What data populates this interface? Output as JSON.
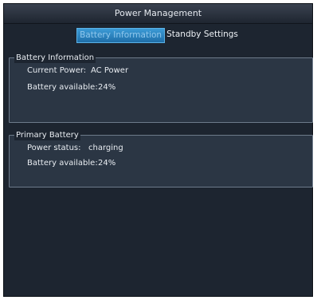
{
  "window": {
    "title": "Power Management"
  },
  "tabs": [
    {
      "label": "Battery Information",
      "active": true
    },
    {
      "label": "Standby Settings",
      "active": false
    }
  ],
  "battery_information": {
    "title": "Battery Information",
    "current_power_label": "Current Power:",
    "current_power_value": "AC Power",
    "battery_available_label": "Battery available:",
    "battery_available_value": "24%"
  },
  "primary_battery": {
    "title": "Primary Battery",
    "power_status_label": "Power status:",
    "power_status_value": "charging",
    "battery_available_label": "Battery available:",
    "battery_available_value": "24%"
  },
  "colors": {
    "accent": "#2a86c6",
    "background": "#1d2530",
    "panel": "#2b3644"
  }
}
